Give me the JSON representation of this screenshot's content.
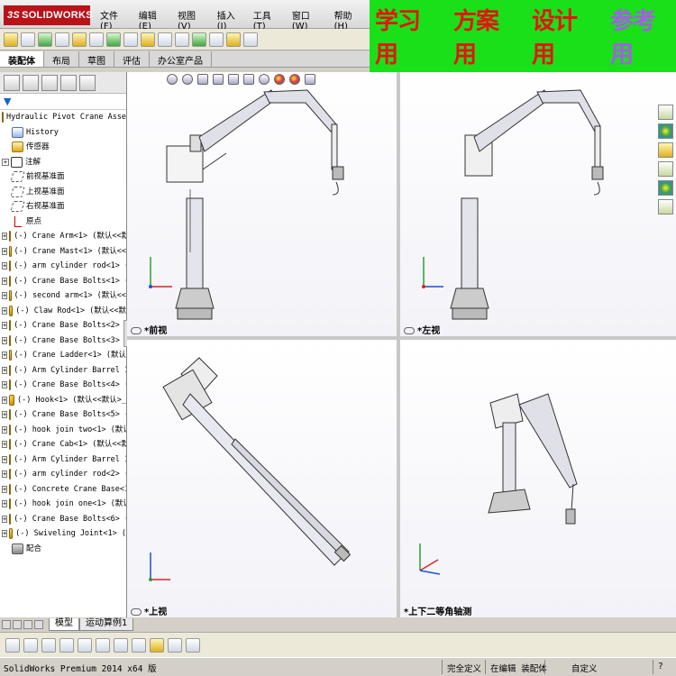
{
  "app": {
    "logo": "SOLIDWORKS",
    "logo_prefix": "3S",
    "menu": [
      "文件(F)",
      "编辑(E)",
      "视图(V)",
      "插入(I)",
      "工具(T)",
      "窗口(W)",
      "帮助(H)"
    ]
  },
  "banner": {
    "items": [
      "学习用",
      "方案用",
      "设计用",
      "参考用"
    ],
    "colors": {
      "primary": "#e8120f",
      "accent": "#a45ee6",
      "background": "#19e019"
    }
  },
  "tabs": [
    "装配体",
    "布局",
    "草图",
    "评估",
    "办公室产品"
  ],
  "tree": {
    "root": "Hydraulic Pivot Crane Assemb",
    "fixed": [
      "History",
      "传感器",
      "注解",
      "前视基准面",
      "上视基准面",
      "右视基准面",
      "原点"
    ],
    "components": [
      "(-) Crane Arm<1> (默认<<默",
      "(-) Crane Mast<1> (默认<<",
      "(-) arm cylinder rod<1> (",
      "(-) Crane Base Bolts<1> (",
      "(-) second arm<1> (默认<<",
      "(-) Claw Rod<1> (默认<<默",
      "(-) Crane Base Bolts<2> (",
      "(-) Crane Base Bolts<3> (",
      "(-) Crane Ladder<1> (默认",
      "(-) Arm Cylinder Barrel 1",
      "(-) Crane Base Bolts<4> (",
      "(-) Hook<1> (默认<<默认>_",
      "(-) Crane Base Bolts<5> (",
      "(-) hook join two<1> (默认",
      "(-) Crane Cab<1> (默认<<默",
      "(-) Arm Cylinder Barrel 1",
      "(-) arm cylinder rod<2> (",
      "(-) Concrete Crane Base<1",
      "(-) hook join one<1> (默认",
      "(-) Crane Base Bolts<6> (",
      "(-) Swiveling Joint<1> ("
    ],
    "mates": "配合"
  },
  "views": {
    "top_left": "*前视",
    "top_right": "*左视",
    "bottom_left": "*上视",
    "bottom_right": "*上下二等角轴测"
  },
  "bottom_tabs": [
    "模型",
    "运动算例1"
  ],
  "status": {
    "product": "SolidWorks Premium 2014 x64 版",
    "definition": "完全定义",
    "mode": "在编辑 装配体",
    "units": "自定义"
  }
}
